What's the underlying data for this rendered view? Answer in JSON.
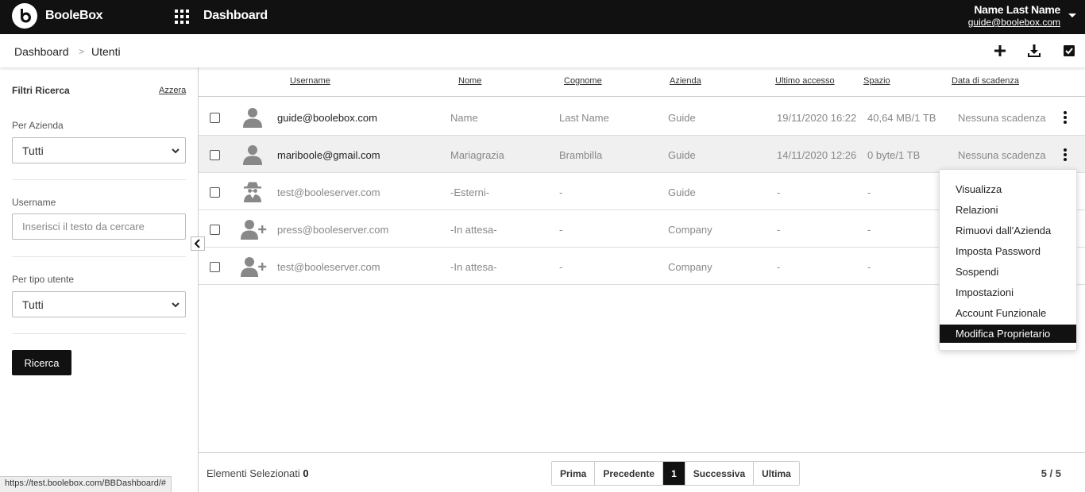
{
  "topbar": {
    "brand": "BooleBox",
    "title": "Dashboard",
    "user_name": "Name Last Name",
    "user_email": "guide@boolebox.com"
  },
  "breadcrumb": {
    "home": "Dashboard",
    "separator": ">",
    "current": "Utenti"
  },
  "sidebar": {
    "title": "Filtri Ricerca",
    "reset": "Azzera",
    "company_label": "Per Azienda",
    "company_value": "Tutti",
    "username_label": "Username",
    "username_placeholder": "Inserisci il testo da cercare",
    "type_label": "Per tipo utente",
    "type_value": "Tutti",
    "search_button": "Ricerca"
  },
  "table": {
    "headers": [
      "Username",
      "Nome",
      "Cognome",
      "Azienda",
      "Ultimo accesso",
      "Spazio",
      "Data di scadenza"
    ],
    "rows": [
      {
        "username": "guide@boolebox.com",
        "nome": "Name",
        "cognome": "Last Name",
        "azienda": "Guide",
        "accesso": "19/11/2020 16:22",
        "spazio": "40,64 MB/1 TB",
        "scadenza": "Nessuna scadenza",
        "avatar": "user-icon"
      },
      {
        "username": "mariboole@gmail.com",
        "nome": "Mariagrazia",
        "cognome": "Brambilla",
        "azienda": "Guide",
        "accesso": "14/11/2020 12:26",
        "spazio": "0 byte/1 TB",
        "scadenza": "Nessuna scadenza",
        "avatar": "user-icon"
      },
      {
        "username": "test@booleserver.com",
        "nome": "-Esterni-",
        "cognome": "-",
        "azienda": "Guide",
        "accesso": "-",
        "spazio": "-",
        "scadenza": "",
        "avatar": "spy-user-icon"
      },
      {
        "username": "press@booleserver.com",
        "nome": "-In attesa-",
        "cognome": "-",
        "azienda": "Company",
        "accesso": "-",
        "spazio": "-",
        "scadenza": "",
        "avatar": "user-plus-icon"
      },
      {
        "username": "test@booleserver.com",
        "nome": "-In attesa-",
        "cognome": "-",
        "azienda": "Company",
        "accesso": "-",
        "spazio": "-",
        "scadenza": "",
        "avatar": "user-plus-icon"
      }
    ]
  },
  "context_menu": {
    "items": [
      "Visualizza",
      "Relazioni",
      "Rimuovi dall'Azienda",
      "Imposta Password",
      "Sospendi",
      "Impostazioni",
      "Account Funzionale",
      "Modifica Proprietario"
    ],
    "active_index": 7
  },
  "footer": {
    "selected_label": "Elementi Selezionati",
    "selected_count": "0",
    "pager": [
      "Prima",
      "Precedente",
      "1",
      "Successiva",
      "Ultima"
    ],
    "current_page": "1",
    "total": "5 / 5"
  },
  "status_url": "https://test.boolebox.com/BBDashboard/#"
}
